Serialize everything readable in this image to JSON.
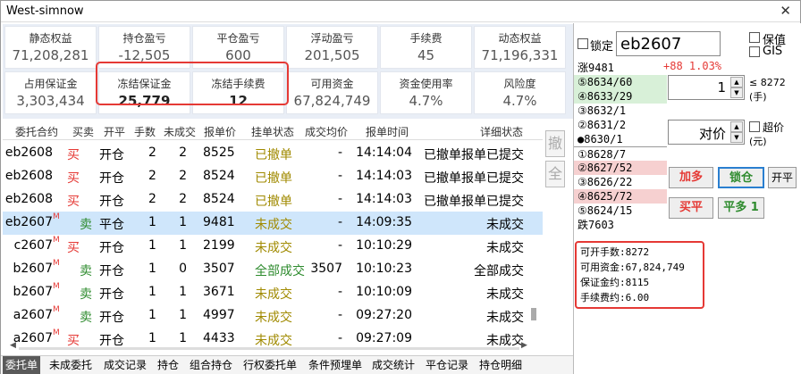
{
  "window": {
    "title": "West-simnow",
    "close": "✕"
  },
  "stats": [
    {
      "label": "静态权益",
      "value": "71,208,281"
    },
    {
      "label": "持仓盈亏",
      "value": "-12,505"
    },
    {
      "label": "平仓盈亏",
      "value": "600"
    },
    {
      "label": "浮动盈亏",
      "value": "201,505"
    },
    {
      "label": "手续费",
      "value": "45"
    },
    {
      "label": "动态权益",
      "value": "71,196,331"
    },
    {
      "label": "占用保证金",
      "value": "3,303,434"
    },
    {
      "label": "冻结保证金",
      "value": "25,779"
    },
    {
      "label": "冻结手续费",
      "value": "12"
    },
    {
      "label": "可用资金",
      "value": "67,824,749"
    },
    {
      "label": "资金使用率",
      "value": "4.7%"
    },
    {
      "label": "风险度",
      "value": "4.7%"
    }
  ],
  "table": {
    "headers": [
      "委托合约",
      "买卖",
      "开平",
      "手数",
      "未成交",
      "报单价",
      "挂单状态",
      "成交均价",
      "报单时间",
      "详细状态"
    ],
    "rows": [
      {
        "contract": "eb2608",
        "sup": "",
        "side": "买",
        "oc": "开仓",
        "qty": "2",
        "unfilled": "2",
        "price": "8525",
        "status": "已撤单",
        "avg": "-",
        "time": "14:14:04",
        "detail": "已撤单报单已提交",
        "selected": false
      },
      {
        "contract": "eb2608",
        "sup": "",
        "side": "买",
        "oc": "开仓",
        "qty": "2",
        "unfilled": "2",
        "price": "8524",
        "status": "已撤单",
        "avg": "-",
        "time": "14:14:03",
        "detail": "已撤单报单已提交",
        "selected": false
      },
      {
        "contract": "eb2608",
        "sup": "",
        "side": "买",
        "oc": "开仓",
        "qty": "2",
        "unfilled": "2",
        "price": "8524",
        "status": "已撤单",
        "avg": "-",
        "time": "14:14:03",
        "detail": "已撤单报单已提交",
        "selected": false
      },
      {
        "contract": "eb2607",
        "sup": "M",
        "side": "卖",
        "oc": "平仓",
        "qty": "1",
        "unfilled": "1",
        "price": "9481",
        "status": "未成交",
        "avg": "-",
        "time": "14:09:35",
        "detail": "未成交",
        "selected": true
      },
      {
        "contract": "c2607",
        "sup": "M",
        "side": "买",
        "oc": "开仓",
        "qty": "1",
        "unfilled": "1",
        "price": "2199",
        "status": "未成交",
        "avg": "-",
        "time": "10:10:29",
        "detail": "未成交",
        "selected": false
      },
      {
        "contract": "b2607",
        "sup": "M",
        "side": "卖",
        "oc": "开仓",
        "qty": "1",
        "unfilled": "0",
        "price": "3507",
        "status": "全部成交",
        "avg": "3507",
        "time": "10:10:23",
        "detail": "全部成交",
        "selected": false
      },
      {
        "contract": "b2607",
        "sup": "M",
        "side": "卖",
        "oc": "开仓",
        "qty": "1",
        "unfilled": "1",
        "price": "3671",
        "status": "未成交",
        "avg": "-",
        "time": "10:10:09",
        "detail": "未成交",
        "selected": false
      },
      {
        "contract": "a2607",
        "sup": "M",
        "side": "卖",
        "oc": "开仓",
        "qty": "1",
        "unfilled": "1",
        "price": "4997",
        "status": "未成交",
        "avg": "-",
        "time": "09:27:20",
        "detail": "未成交",
        "selected": false
      },
      {
        "contract": "a2607",
        "sup": "M",
        "side": "买",
        "oc": "开仓",
        "qty": "1",
        "unfilled": "1",
        "price": "4433",
        "status": "未成交",
        "avg": "-",
        "time": "09:27:09",
        "detail": "未成交",
        "selected": false
      }
    ]
  },
  "side_buttons": {
    "cancel": "撤",
    "all": "全"
  },
  "tabs": [
    "委托单",
    "未成委托",
    "成交记录",
    "持仓",
    "组合持仓",
    "行权委托单",
    "条件预埋单",
    "成交统计",
    "平仓记录",
    "持仓明细"
  ],
  "right": {
    "lock_label": "锁定",
    "code": "eb2607",
    "margin_label": "保值",
    "gis_label": "GIS",
    "limit_up": "涨9481",
    "change": "+88 1.03%",
    "asks": [
      "⑤8634/60",
      "④8633/29",
      "③8632/1",
      "②8631/2",
      "●8630/1"
    ],
    "bids": [
      "①8628/7",
      "②8627/52",
      "③8626/22",
      "④8625/72",
      "⑤8624/15"
    ],
    "limit_down": "跌7603",
    "qty": "1",
    "qty_hint": "≤ 8272",
    "qty_unit": "(手)",
    "price_type": "对价",
    "super_price": "超价",
    "price_unit": "(元)",
    "buttons": {
      "add_long": "加多",
      "lock": "锁仓",
      "open": "开平",
      "buy_close": "买平",
      "close_long": "平多 1"
    },
    "info": [
      "可开手数:8272",
      "可用资金:67,824,749",
      "保证金约:8115",
      "手续费约:6.00"
    ]
  }
}
